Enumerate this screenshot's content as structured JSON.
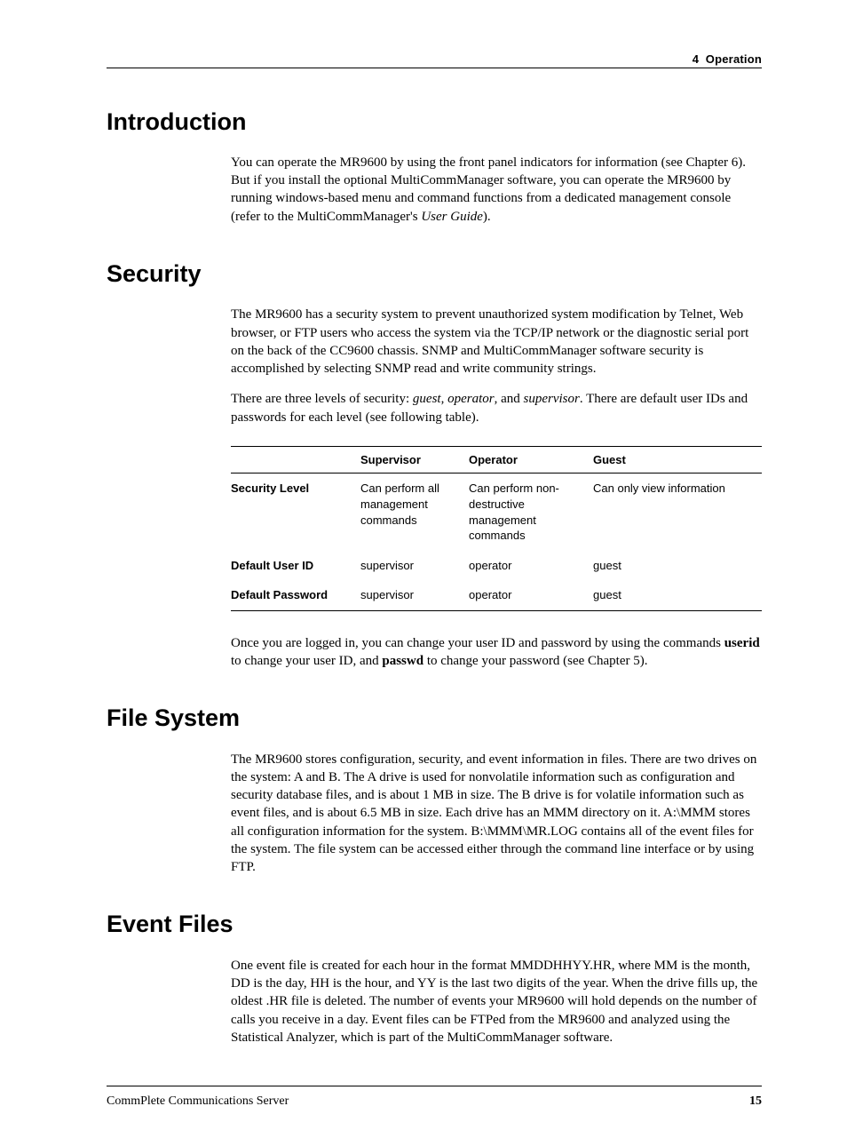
{
  "header": {
    "chapter_num": "4",
    "chapter_title": "Operation"
  },
  "sections": {
    "intro": {
      "title": "Introduction",
      "p1a": "You can operate the MR9600 by using the front panel indicators for information (see Chapter 6). But if you install the optional MultiCommManager software, you can operate the MR9600 by running windows-based menu and command functions from a dedicated management console (refer to the MultiCommManager's ",
      "p1_italic": "User Guide",
      "p1b": ")."
    },
    "security": {
      "title": "Security",
      "p1": "The MR9600 has a security system to prevent unauthorized system modification by Telnet, Web browser, or FTP users who access the system via the TCP/IP network or the diagnostic serial port on the back of the CC9600 chassis. SNMP and MultiCommManager software security is accomplished by selecting SNMP read and write community strings.",
      "p2a": "There are three levels of security: ",
      "p2_i1": "guest",
      "p2b": ", ",
      "p2_i2": "operator",
      "p2c": ", and ",
      "p2_i3": "supervisor",
      "p2d": ". There are default user IDs and  passwords for each level (see following table).",
      "table": {
        "columns": [
          "",
          "Supervisor",
          "Operator",
          "Guest"
        ],
        "rows": [
          {
            "label": "Security Level",
            "c1": "Can perform all management commands",
            "c2": "Can perform non-destructive management commands",
            "c3": "Can only view information"
          },
          {
            "label": "Default User ID",
            "c1": "supervisor",
            "c2": "operator",
            "c3": "guest"
          },
          {
            "label": "Default Password",
            "c1": "supervisor",
            "c2": "operator",
            "c3": "guest"
          }
        ]
      },
      "p3a": "Once you are logged in, you can change your user ID and password by using the commands ",
      "p3_b1": "userid",
      "p3b": " to change your user ID, and ",
      "p3_b2": "passwd",
      "p3c": " to change your password (see Chapter 5)."
    },
    "filesys": {
      "title": "File System",
      "p1": "The MR9600 stores configuration, security, and event information in files. There are two drives on the system: A and B. The A drive is used for nonvolatile information such as configuration and security database files, and is about 1 MB in size. The B drive is for volatile information such as event files, and is about 6.5 MB in size. Each drive has an MMM directory on it. A:\\MMM stores all configuration information for the system. B:\\MMM\\MR.LOG contains all of the event files for the system. The file system can be accessed either through the command line interface or by using FTP."
    },
    "eventfiles": {
      "title": "Event Files",
      "p1": "One event file is created for each hour in the format MMDDHHYY.HR, where MM is the month, DD is the day, HH is the hour, and YY is the last two digits of the year. When the drive fills up, the oldest .HR file is deleted. The number of events your MR9600 will hold depends on the number of calls you receive in a day. Event files can be FTPed from the MR9600 and analyzed using the Statistical Analyzer, which is part of the MultiCommManager software."
    }
  },
  "footer": {
    "title": "CommPlete Communications Server",
    "page": "15"
  }
}
